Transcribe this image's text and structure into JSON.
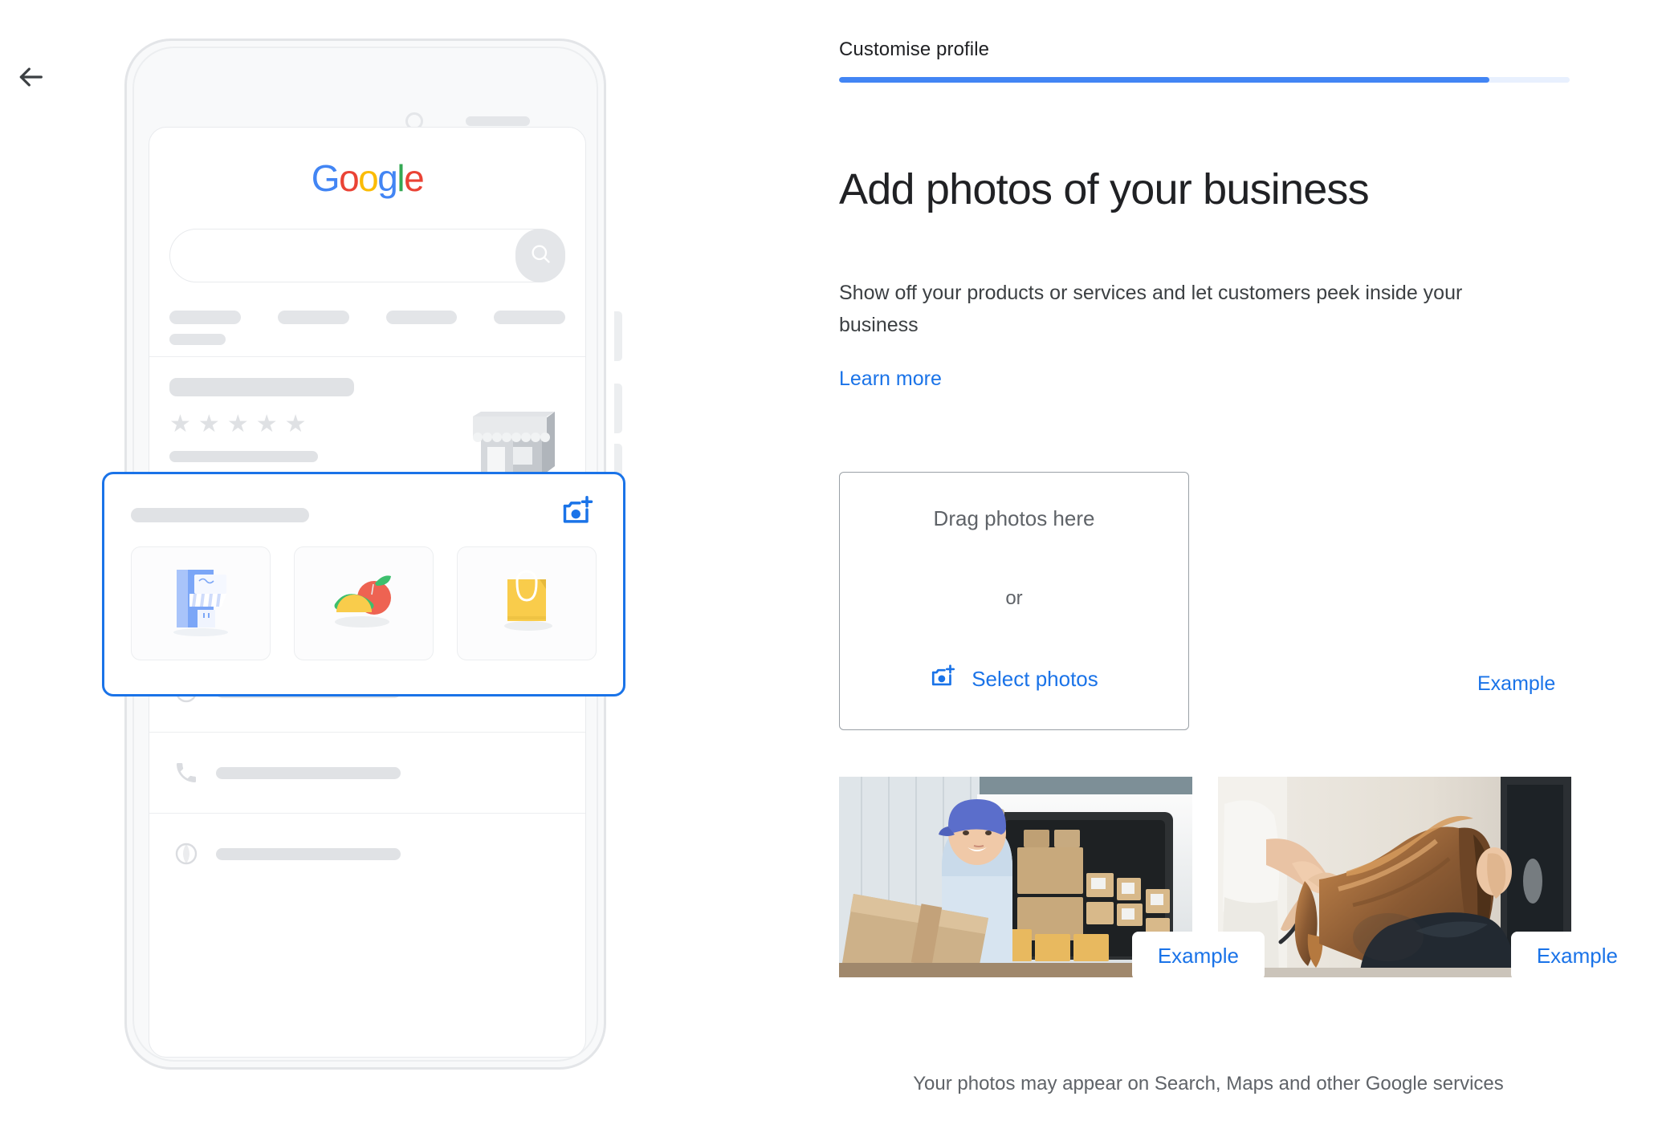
{
  "nav": {
    "back_icon": "arrow-left-icon"
  },
  "header": {
    "step_label": "Customise profile",
    "progress_percent": 89,
    "progress_fill_color": "#4285f4",
    "progress_track_color": "#e8f0fe"
  },
  "main": {
    "headline": "Add photos of your business",
    "subtext": "Show off your products or services and let customers peek inside your business",
    "learn_more_label": "Learn more",
    "learn_more_color": "#1a73e8"
  },
  "dropzone": {
    "drag_label": "Drag photos here",
    "or_label": "or",
    "select_label": "Select photos",
    "select_icon": "add-a-photo-icon",
    "border_color": "#9aa0a6"
  },
  "example_link": {
    "label": "Example"
  },
  "thumbnails": [
    {
      "alt": "delivery-person-with-box-photo",
      "badge_label": "Example"
    },
    {
      "alt": "hairdresser-styling-hair-photo",
      "badge_label": "Example"
    }
  ],
  "footnote": "Your photos may appear on Search, Maps and other Google services",
  "phone": {
    "google_logo_letters": [
      "G",
      "o",
      "o",
      "g",
      "l",
      "e"
    ],
    "search_icon": "search-icon",
    "chips": [
      "chip-1",
      "chip-2",
      "chip-3",
      "chip-4"
    ],
    "listing": {
      "star_glyph": "★",
      "star_count": 5,
      "storefront_icon": "storefront-illustration"
    },
    "photo_card": {
      "add_photo_icon": "add-a-photo-icon",
      "highlight_color": "#1a73e8",
      "tiles": [
        {
          "icon": "storefront-tile-icon"
        },
        {
          "icon": "food-tile-icon"
        },
        {
          "icon": "shopping-bag-tile-icon"
        }
      ]
    },
    "info_rows": [
      {
        "icon": "location-pin-icon"
      },
      {
        "icon": "clock-icon"
      },
      {
        "icon": "phone-icon"
      },
      {
        "icon": "globe-icon"
      }
    ],
    "map_thumb_icon": "map-pin-thumbnail"
  }
}
